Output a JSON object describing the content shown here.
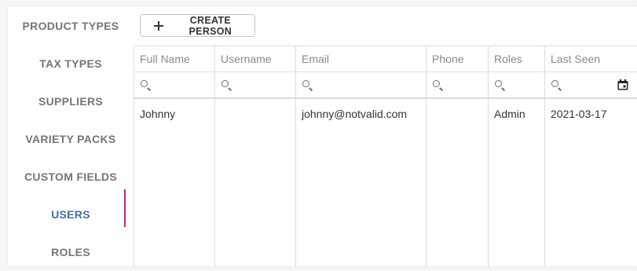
{
  "sidebar": {
    "items": [
      {
        "label": "PRODUCT TYPES"
      },
      {
        "label": "TAX TYPES"
      },
      {
        "label": "SUPPLIERS"
      },
      {
        "label": "VARIETY PACKS"
      },
      {
        "label": "CUSTOM FIELDS"
      },
      {
        "label": "USERS",
        "active": true
      },
      {
        "label": "ROLES"
      }
    ],
    "active_color": "#3f6ea8",
    "indicator_color": "#e6196b"
  },
  "toolbar": {
    "create_label": "CREATE PERSON",
    "create_icon": "plus-icon"
  },
  "table": {
    "columns": [
      {
        "label": "Full Name",
        "filter_icon": "search-icon"
      },
      {
        "label": "Username",
        "filter_icon": "search-icon"
      },
      {
        "label": "Email",
        "filter_icon": "search-icon"
      },
      {
        "label": "Phone",
        "filter_icon": "search-icon"
      },
      {
        "label": "Roles",
        "filter_icon": "search-icon"
      },
      {
        "label": "Last Seen",
        "filter_icon": "search-icon",
        "extra_icon": "calendar-icon"
      }
    ],
    "rows": [
      {
        "full_name": "Johnny",
        "username": "",
        "email": "johnny@notvalid.com",
        "phone": "",
        "roles": "Admin",
        "last_seen": "2021-03-17"
      }
    ]
  }
}
